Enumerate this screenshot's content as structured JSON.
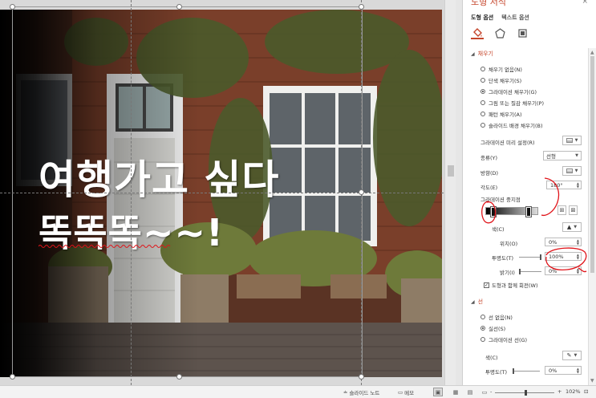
{
  "slide": {
    "title_line1": "여행가고 싶다",
    "title_line2": "똑똑똑~~!"
  },
  "pane": {
    "title": "도형 서식",
    "close": "×",
    "tabs": [
      "도형 옵션",
      "텍스트 옵션"
    ],
    "icons": [
      "fill-line-icon",
      "effects-icon",
      "size-properties-icon"
    ],
    "fill": {
      "header": "채우기",
      "options": [
        {
          "label": "채우기 없음(N)",
          "selected": false
        },
        {
          "label": "단색 채우기(S)",
          "selected": false
        },
        {
          "label": "그라데이션 채우기(G)",
          "selected": true
        },
        {
          "label": "그림 또는 질감 채우기(P)",
          "selected": false
        },
        {
          "label": "패턴 채우기(A)",
          "selected": false
        },
        {
          "label": "슬라이드 배경 채우기(B)",
          "selected": false
        }
      ],
      "preset_label": "그라데이션 미리 설정(R)",
      "type_label": "종류(Y)",
      "type_value": "선형",
      "direction_label": "방향(D)",
      "angle_label": "각도(E)",
      "angle_value": "180°",
      "stops_label": "그라데이션 중지점",
      "color_label": "색(C)",
      "position_label": "위치(O)",
      "position_value": "0%",
      "transparency_label": "투명도(T)",
      "transparency_value": "100%",
      "transparency_level": 1.0,
      "brightness_label": "밝기(I)",
      "brightness_value": "0%",
      "rotate_label": "도형과 함께 회전(W)",
      "rotate_checked": true
    },
    "line": {
      "header": "선",
      "options": [
        {
          "label": "선 없음(N)",
          "selected": false
        },
        {
          "label": "실선(S)",
          "selected": true
        },
        {
          "label": "그라데이션 선(G)",
          "selected": false
        }
      ],
      "color_label": "색(C)",
      "transparency_label": "투명도(T)",
      "transparency_value": "0%"
    }
  },
  "status": {
    "notes_label": "슬라이드 노트",
    "comments_label": "메모",
    "zoom_value": "102%",
    "zoom_minus": "-",
    "zoom_plus": "+"
  },
  "colors": {
    "accent": "#c5452b",
    "annotation": "#e0141a"
  }
}
